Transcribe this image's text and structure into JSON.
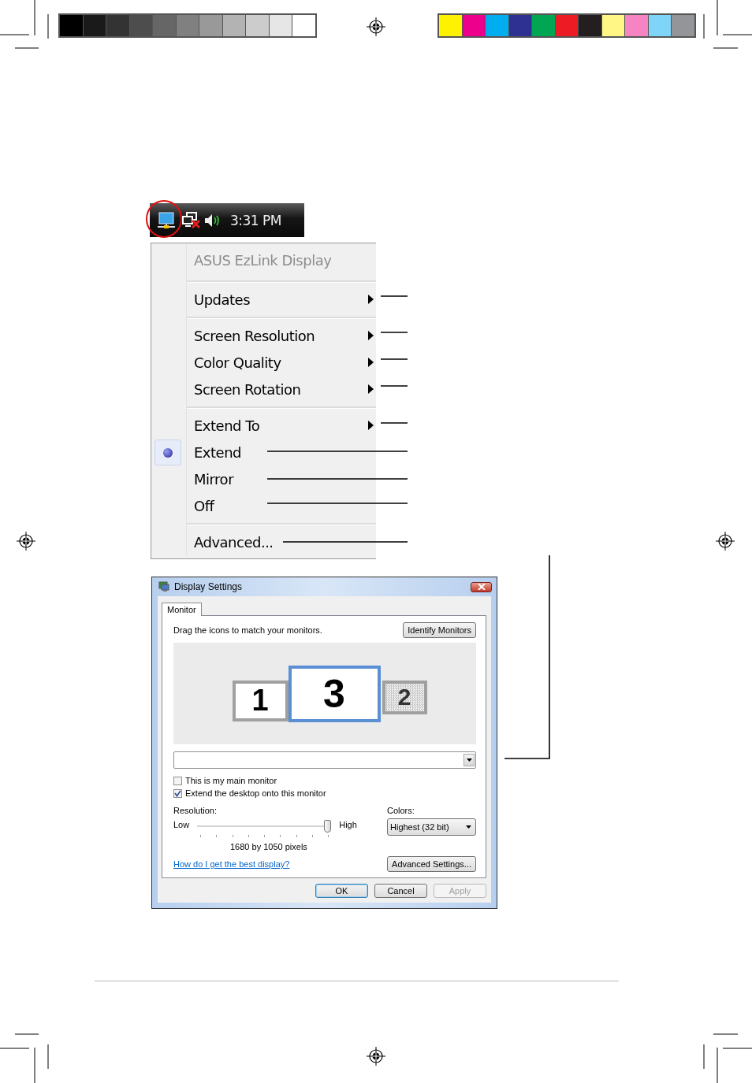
{
  "taskbar": {
    "time": "3:31 PM",
    "highlighted": true
  },
  "context_menu": {
    "items": [
      {
        "kind": "header",
        "label": "ASUS EzLink Display"
      },
      {
        "kind": "separator"
      },
      {
        "kind": "item",
        "label": "Updates",
        "submenu": true,
        "selected": false
      },
      {
        "kind": "separator"
      },
      {
        "kind": "item",
        "label": "Screen Resolution",
        "submenu": true,
        "selected": false
      },
      {
        "kind": "item",
        "label": "Color Quality",
        "submenu": true,
        "selected": false
      },
      {
        "kind": "item",
        "label": "Screen Rotation",
        "submenu": true,
        "selected": false
      },
      {
        "kind": "separator"
      },
      {
        "kind": "item",
        "label": "Extend To",
        "submenu": true,
        "selected": false
      },
      {
        "kind": "item",
        "label": "Extend",
        "submenu": false,
        "selected": true
      },
      {
        "kind": "item",
        "label": "Mirror",
        "submenu": false,
        "selected": false
      },
      {
        "kind": "item",
        "label": "Off",
        "submenu": false,
        "selected": false
      },
      {
        "kind": "separator"
      },
      {
        "kind": "item",
        "label": "Advanced...",
        "submenu": false,
        "selected": false
      }
    ]
  },
  "dialog": {
    "title": "Display Settings",
    "tabs": [
      {
        "label": "Monitor",
        "selected": true
      }
    ],
    "instruction": "Drag the icons to match your monitors.",
    "identify_button": "Identify Monitors",
    "monitors": [
      {
        "label": "1",
        "selected": false,
        "active": true
      },
      {
        "label": "3",
        "selected": true,
        "active": true
      },
      {
        "label": "2",
        "selected": false,
        "active": false
      }
    ],
    "checkboxes": [
      {
        "label": "This is my main monitor",
        "checked": false
      },
      {
        "label": "Extend the desktop onto this monitor",
        "checked": true
      }
    ],
    "resolution": {
      "label": "Resolution:",
      "low": "Low",
      "high": "High",
      "level": 1,
      "reading": "1680 by 1050 pixels"
    },
    "colors": {
      "label": "Colors:",
      "value": "Highest (32 bit)"
    },
    "help_link": "How do I get the best display?",
    "advanced_button": "Advanced Settings...",
    "buttons": [
      {
        "label": "OK",
        "default": true,
        "disabled": false
      },
      {
        "label": "Cancel",
        "default": false,
        "disabled": false
      },
      {
        "label": "Apply",
        "default": false,
        "disabled": true
      }
    ]
  }
}
